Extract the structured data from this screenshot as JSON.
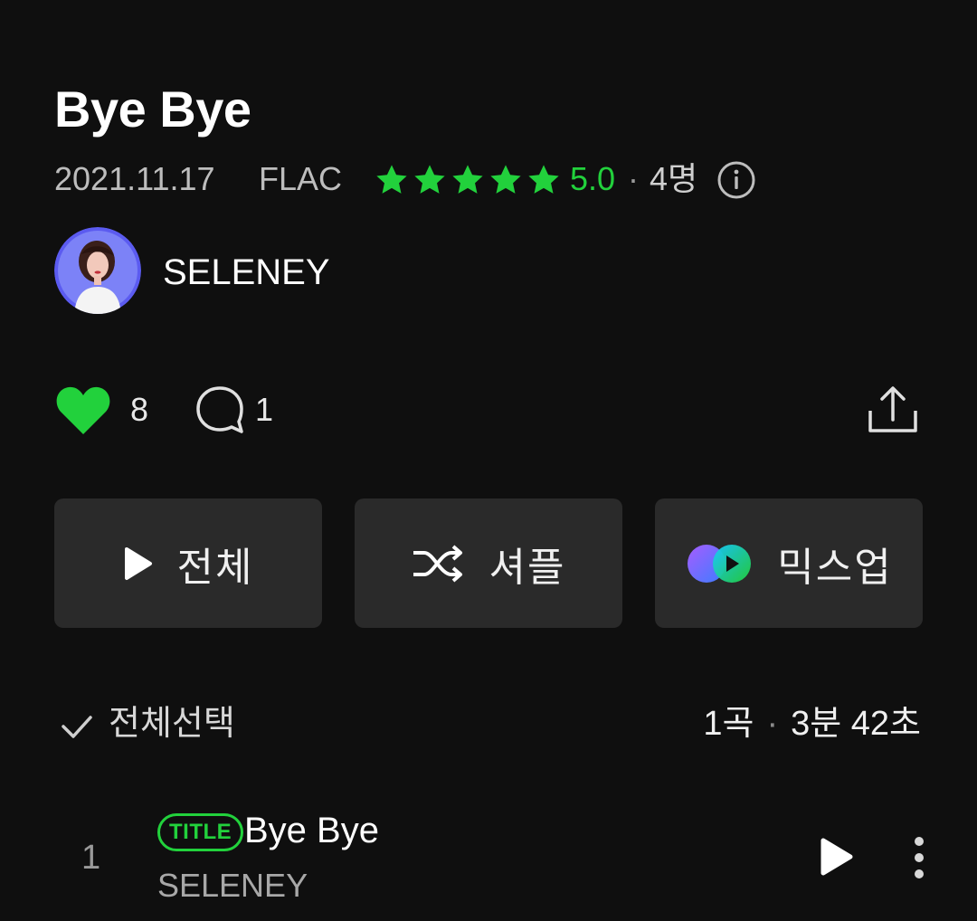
{
  "album": {
    "title": "Bye Bye",
    "release_date": "2021.11.17",
    "format": "FLAC",
    "rating_value": "5.0",
    "rating_stars": 5,
    "rating_separator": "·",
    "raters": "4명"
  },
  "artist": {
    "name": "SELENEY"
  },
  "social": {
    "likes": "8",
    "comments": "1"
  },
  "actions": {
    "play_all": "전체",
    "shuffle": "셔플",
    "mixup": "믹스업"
  },
  "tracklist": {
    "select_all": "전체선택",
    "count": "1곡",
    "separator": "·",
    "duration": "3분 42초",
    "tracks": [
      {
        "number": "1",
        "badge": "TITLE",
        "title": "Bye Bye",
        "artist": "SELENEY"
      }
    ]
  },
  "colors": {
    "accent": "#22d13c",
    "background": "#0f0f0f",
    "button": "#2a2a2a"
  },
  "icons": [
    "star-icon",
    "info-icon",
    "heart-icon",
    "comment-icon",
    "share-icon",
    "play-icon",
    "shuffle-icon",
    "mixup-icon",
    "check-icon",
    "more-icon"
  ]
}
